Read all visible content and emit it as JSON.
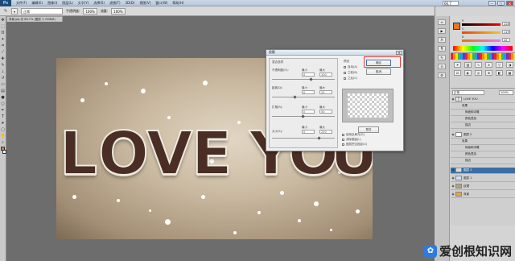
{
  "app": {
    "logo": "Ps",
    "window_controls": [
      "—",
      "□",
      "✕"
    ]
  },
  "menubar": {
    "items": [
      "文件(F)",
      "编辑(E)",
      "图像(I)",
      "图层(L)",
      "文字(Y)",
      "选择(S)",
      "滤镜(T)",
      "3D(D)",
      "视图(V)",
      "窗口(W)",
      "帮助(H)"
    ],
    "zoom": "66.7"
  },
  "options": {
    "mode_label": "正常",
    "opacity_label": "不透明度:",
    "opacity_value": "100%",
    "flow_label": "流量:",
    "flow_value": "100%"
  },
  "document": {
    "tab_title": "背景.jpg @ 66.7% (图层 1, RGB/8)"
  },
  "canvas": {
    "letters": [
      "L",
      "O",
      "V",
      "E",
      "Y",
      "O",
      "U"
    ]
  },
  "dialog": {
    "title": "投影",
    "close": "✕",
    "group1_label": "混合选项",
    "fields": [
      {
        "label": "不透明度(O):",
        "min": "最小",
        "max": "最大",
        "v1": "0",
        "v2": "100"
      },
      {
        "label": "距离(D):",
        "min": "最小",
        "max": "最大",
        "v1": "0",
        "v2": "25"
      },
      {
        "label": "扩展(R):",
        "min": "最小",
        "max": "最大",
        "v1": "0",
        "v2": "50"
      },
      {
        "label": "大小(S):",
        "min": "最小",
        "max": "最大",
        "v1": "0",
        "v2": "250"
      }
    ],
    "options_label": "预设",
    "checks": [
      "自动(A)",
      "之前(B)",
      "之后(C)"
    ],
    "bottom_checks": [
      "使用全局光(G)",
      "消除锯齿(L)",
      "图层挖空投影(U)"
    ],
    "ok_label": "确定",
    "cancel_label": "取消",
    "preview_label": "预览"
  },
  "colors": {
    "accent_highlight": "#e23c3c",
    "selected_layer": "#3a6ea5"
  },
  "color_panel": {
    "rows": [
      {
        "label": "R",
        "value": "228"
      },
      {
        "label": "G",
        "value": "119"
      },
      {
        "label": "B",
        "value": "42"
      }
    ]
  },
  "layers": {
    "mode": "正常",
    "opacity": "100%",
    "rows": [
      {
        "name": "LOVE YOU",
        "selected": false
      },
      {
        "name": "效果",
        "selected": false
      },
      {
        "name": "斜面和浮雕",
        "selected": false
      },
      {
        "name": "颜色叠加",
        "selected": false
      },
      {
        "name": "描边",
        "selected": false
      },
      {
        "name": "图层 2",
        "selected": false
      },
      {
        "name": "效果",
        "selected": false
      },
      {
        "name": "斜面和浮雕",
        "selected": false
      },
      {
        "name": "颜色叠加",
        "selected": false
      },
      {
        "name": "描边",
        "selected": false
      },
      {
        "name": "图层 3",
        "selected": true
      },
      {
        "name": "图层 1",
        "selected": false
      },
      {
        "name": "纹理",
        "selected": false
      },
      {
        "name": "背景",
        "selected": false
      }
    ]
  },
  "watermark": {
    "text": "爱创根知识网"
  }
}
